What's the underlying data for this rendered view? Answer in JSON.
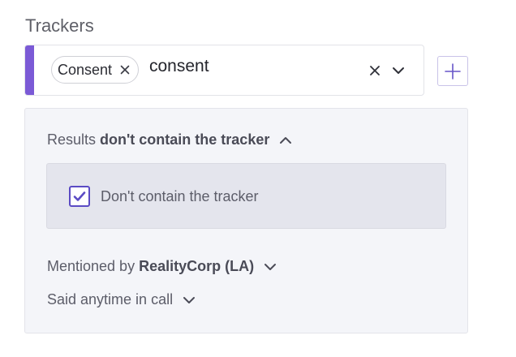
{
  "section": {
    "title": "Trackers"
  },
  "select": {
    "chips": [
      {
        "label": "Consent"
      }
    ],
    "search_value": "consent",
    "accent_color": "#7b5ad6"
  },
  "filters": {
    "results": {
      "prefix": "Results",
      "value": "don't contain the tracker"
    },
    "checkbox": {
      "label": "Don't contain the tracker",
      "checked": true
    },
    "mentioned": {
      "prefix": "Mentioned by",
      "value": "RealityCorp (LA)"
    },
    "said": {
      "label": "Said anytime in call"
    }
  },
  "colors": {
    "accent": "#5b4bc4",
    "panel_bg": "#f4f5f9",
    "inner_bg": "#e4e5ed"
  }
}
